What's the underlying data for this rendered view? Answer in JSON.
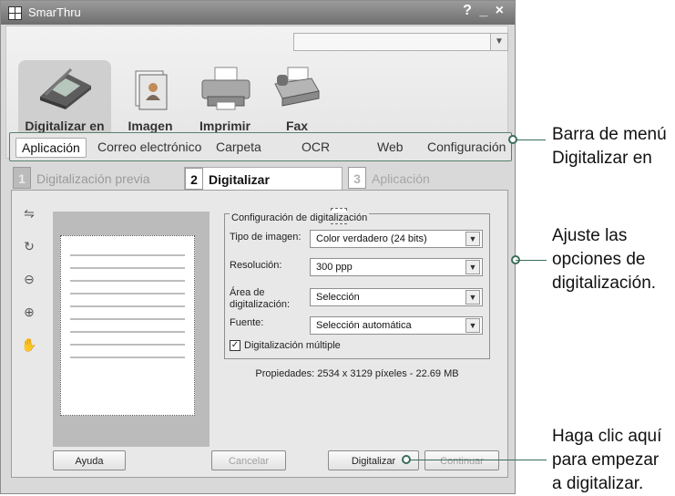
{
  "window": {
    "title": "SmarThru",
    "controls": "? _ ×",
    "search_placeholder": ""
  },
  "modes": [
    {
      "label": "Digitalizar en",
      "icon": "scanner-icon"
    },
    {
      "label": "Imagen",
      "icon": "image-book-icon"
    },
    {
      "label": "Imprimir",
      "icon": "printer-icon"
    },
    {
      "label": "Fax",
      "icon": "fax-icon"
    }
  ],
  "menu": {
    "items": [
      "Aplicación",
      "Correo electrónico",
      "Carpeta",
      "OCR",
      "Web",
      "Configuración"
    ],
    "active": "Aplicación"
  },
  "steps": [
    {
      "num": "1",
      "label": "Digitalización previa"
    },
    {
      "num": "2",
      "label": "Digitalizar"
    },
    {
      "num": "3",
      "label": "Aplicación"
    }
  ],
  "settings": {
    "title": "Configuración de digitalización",
    "image_type_label": "Tipo de imagen:",
    "image_type_value": "Color verdadero (24 bits)",
    "resolution_label": "Resolución:",
    "resolution_value": "300 ppp",
    "area_label_line1": "Área de",
    "area_label_line2": "digitalización:",
    "area_value": "Selección",
    "source_label": "Fuente:",
    "source_value": "Selección automática",
    "multiple_label": "Digitalización múltiple",
    "multiple_checked": true,
    "properties": "Propiedades: 2534 x 3129 píxeles - 22.69 MB"
  },
  "buttons": {
    "help": "Ayuda",
    "cancel": "Cancelar",
    "scan": "Digitalizar",
    "continue": "Continuar"
  },
  "annotations": {
    "menu_line1": "Barra de menú",
    "menu_line2": "Digitalizar en",
    "options_line1": "Ajuste las",
    "options_line2": "opciones de",
    "options_line3": "digitalización.",
    "scan_line1": "Haga clic aquí",
    "scan_line2": "para empezar",
    "scan_line3": "a digitalizar."
  }
}
